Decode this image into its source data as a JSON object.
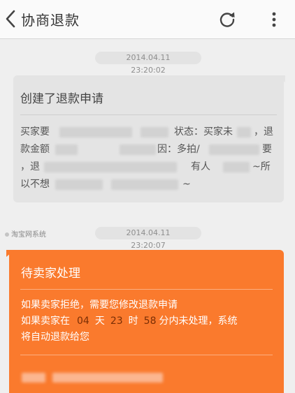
{
  "header": {
    "title": "协商退款"
  },
  "messages": [
    {
      "timestamp": "2014.04.11 23:20:02",
      "title": "创建了退款申请",
      "body_line1": "买家要",
      "body_line1_b": "状态：买家未",
      "body_line1_c": "，退",
      "body_line2": "款金额",
      "body_line2_b": "因：多拍/",
      "body_line2_c": "要",
      "body_line3": "，退",
      "body_line3_b": "有人",
      "body_line3_c": "~所",
      "body_line4": "以不想",
      "body_line4_b": "~"
    },
    {
      "timestamp": "2014.04.11 23:20:07",
      "sender": "淘宝网系统",
      "title": "待卖家处理",
      "line1": "如果卖家拒绝，需要您修改退款申请",
      "line2_prefix": "如果卖家在",
      "days": "04",
      "days_unit": "天",
      "hours": "23",
      "hours_unit": "时",
      "minutes": "58",
      "line2_suffix": "分内未处理，系统",
      "line3": "将自动退款给您"
    }
  ],
  "colors": {
    "accent": "#fa7a2d",
    "bubble_gray": "#e4e4e4",
    "background": "#efefef"
  },
  "icons": [
    "back-chevron-icon",
    "refresh-icon",
    "more-vertical-icon"
  ]
}
